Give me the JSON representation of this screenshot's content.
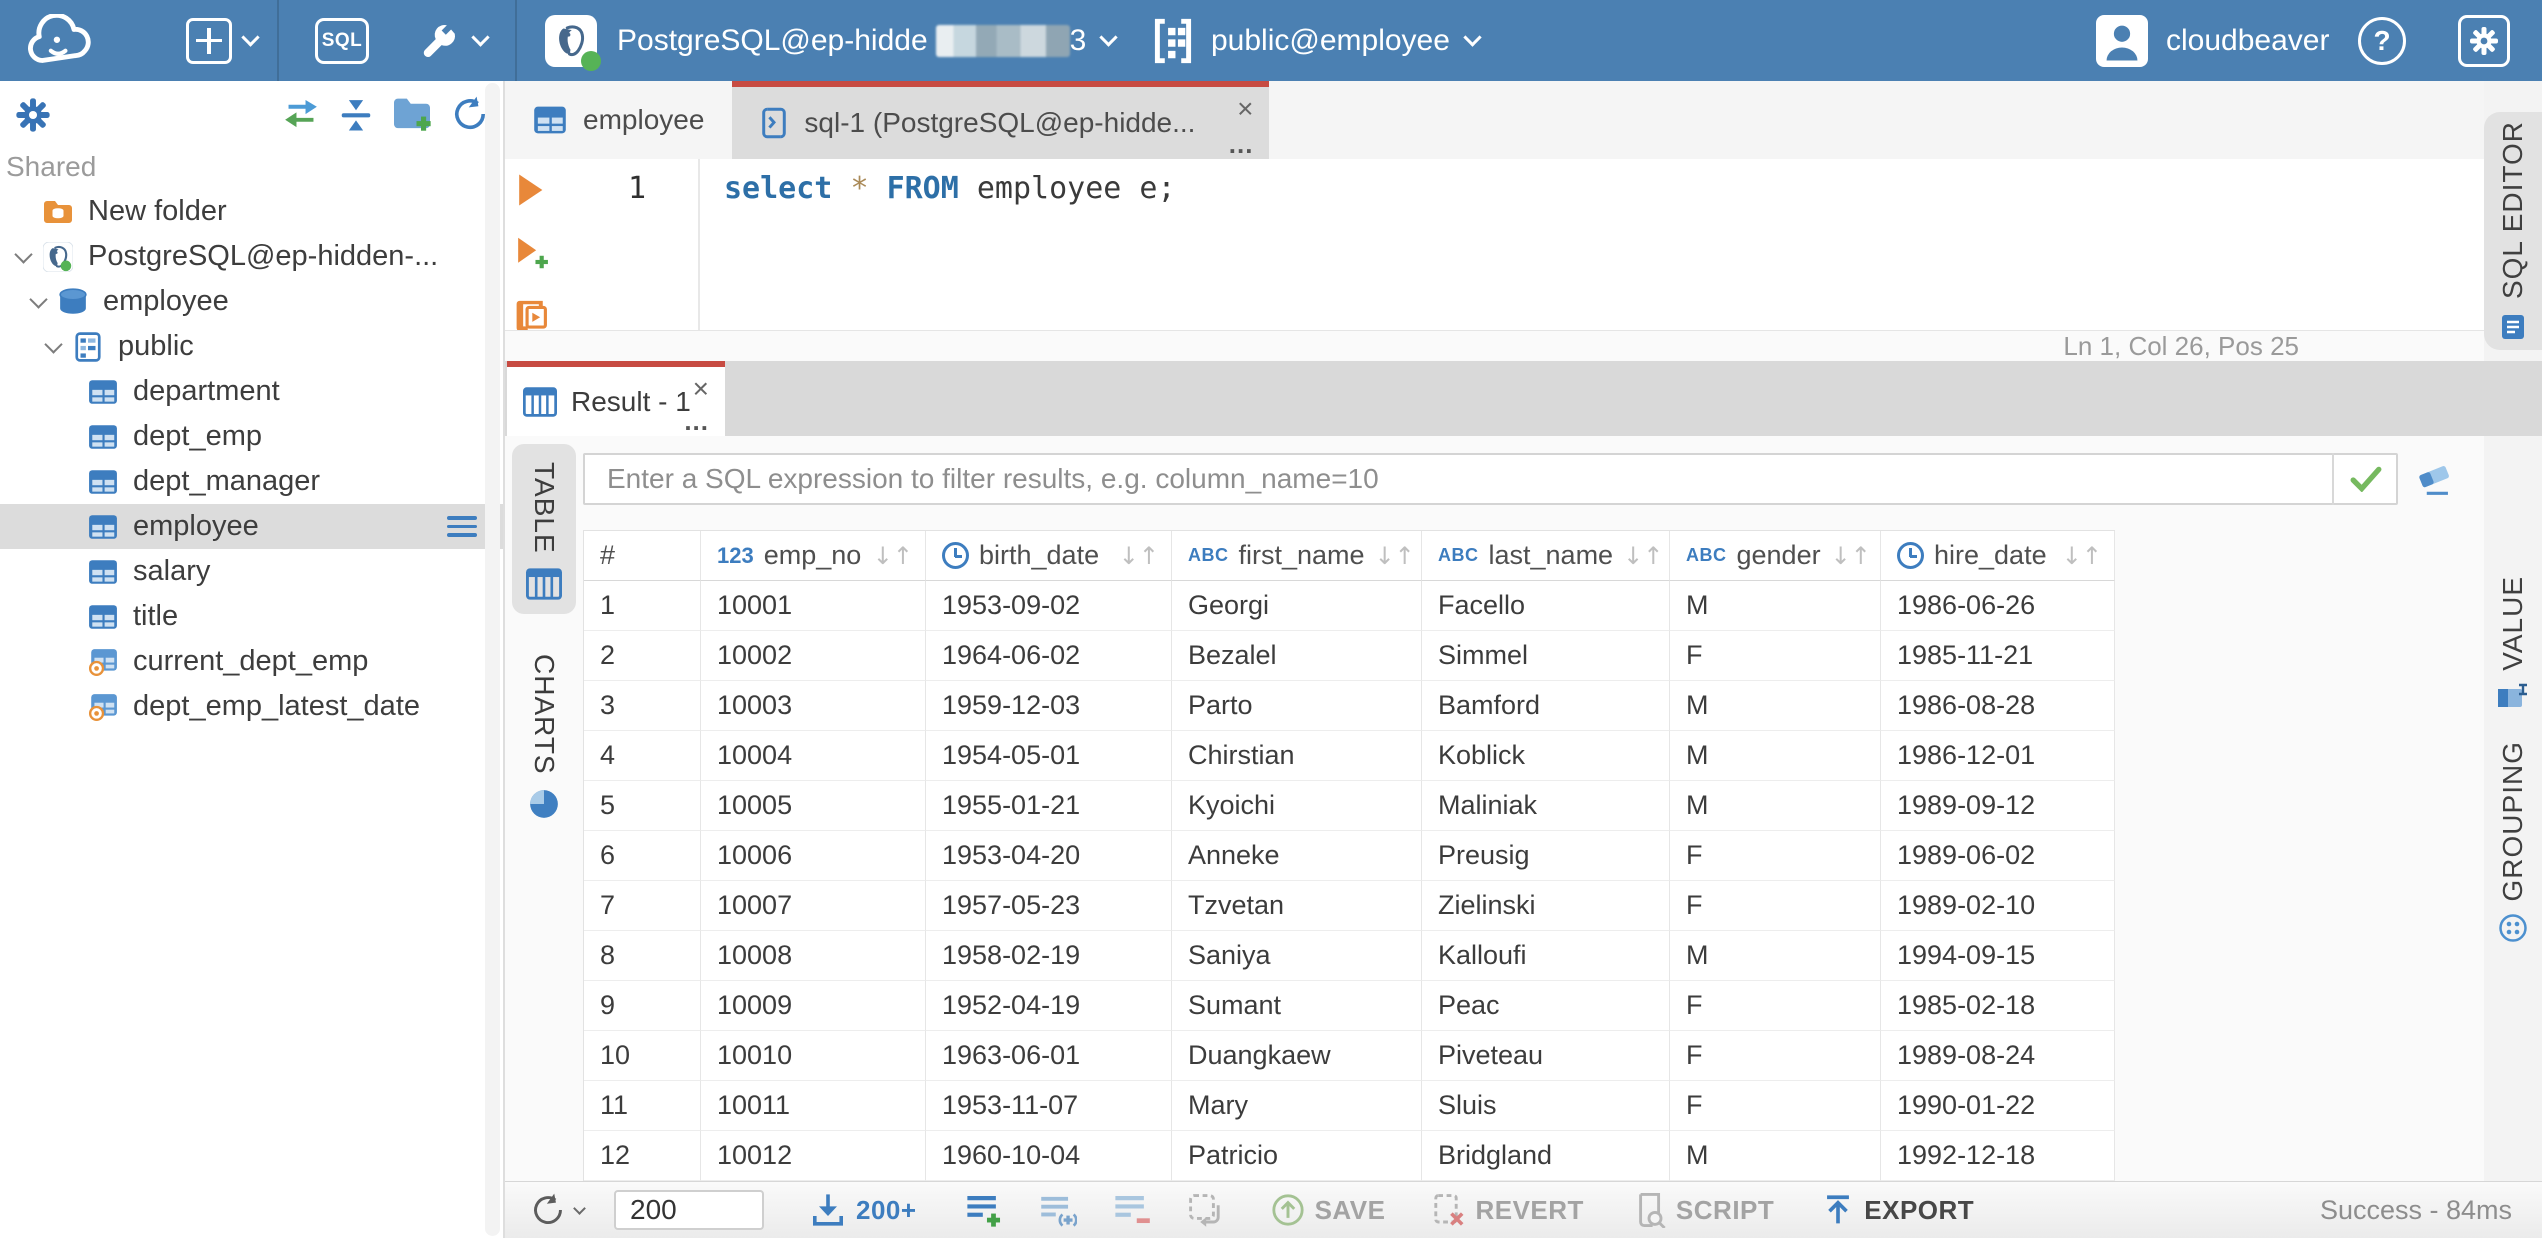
{
  "colors": {
    "topbar": "#4b80b2",
    "accent_red": "#c74b42",
    "icon_blue": "#3d7dbf",
    "status_green": "#56b356",
    "selected_gray": "#dcdcdc"
  },
  "topbar": {
    "new_object_tooltip": "new-object",
    "sql_badge": "SQL",
    "connection": {
      "name_visible": "PostgreSQL@ep-hidde",
      "name_suffix": "3"
    },
    "schema": "public@employee",
    "user": "cloudbeaver",
    "help_glyph": "?"
  },
  "sidebar": {
    "section": "Shared",
    "items": [
      {
        "label": "New folder",
        "icon": "folder-db",
        "level": 0,
        "chevron": false
      },
      {
        "label": "PostgreSQL@ep-hidden-...",
        "icon": "postgres",
        "level": 0,
        "chevron": true
      },
      {
        "label": "employee",
        "icon": "database",
        "level": 1,
        "chevron": true
      },
      {
        "label": "public",
        "icon": "schema",
        "level": 2,
        "chevron": true
      },
      {
        "label": "department",
        "icon": "table",
        "level": 3,
        "chevron": false
      },
      {
        "label": "dept_emp",
        "icon": "table",
        "level": 3,
        "chevron": false
      },
      {
        "label": "dept_manager",
        "icon": "table",
        "level": 3,
        "chevron": false
      },
      {
        "label": "employee",
        "icon": "table",
        "level": 3,
        "chevron": false,
        "selected": true
      },
      {
        "label": "salary",
        "icon": "table",
        "level": 3,
        "chevron": false
      },
      {
        "label": "title",
        "icon": "table",
        "level": 3,
        "chevron": false
      },
      {
        "label": "current_dept_emp",
        "icon": "view",
        "level": 3,
        "chevron": false
      },
      {
        "label": "dept_emp_latest_date",
        "icon": "view",
        "level": 3,
        "chevron": false
      }
    ]
  },
  "editor_tabs": [
    {
      "label": "employee"
    },
    {
      "label": "sql-1 (PostgreSQL@ep-hidde..."
    }
  ],
  "tabs_meta": {
    "close": "×",
    "more": "..."
  },
  "sql": {
    "line_number": "1",
    "kw1": "select",
    "sp1": " ",
    "star": "*",
    "sp2": " ",
    "kw2": "FROM",
    "rest": " employee e;",
    "status": "Ln 1, Col 26, Pos 25"
  },
  "right_rail": {
    "editor_tab": "SQL EDITOR",
    "value_tab": "VALUE",
    "grouping_tab": "GROUPING"
  },
  "result": {
    "tab": "Result - 1",
    "filter_placeholder": "Enter a SQL expression to filter results, e.g. column_name=10",
    "left_tabs": [
      {
        "label": "TABLE"
      },
      {
        "label": "CHARTS"
      }
    ],
    "grid": {
      "row_header": "#",
      "sort_glyph": "↓↑",
      "type_badges": {
        "number": "123",
        "string": "ABC"
      },
      "columns": [
        {
          "name": "emp_no",
          "type": "number"
        },
        {
          "name": "birth_date",
          "type": "date"
        },
        {
          "name": "first_name",
          "type": "string"
        },
        {
          "name": "last_name",
          "type": "string"
        },
        {
          "name": "gender",
          "type": "string"
        },
        {
          "name": "hire_date",
          "type": "date"
        }
      ],
      "rows": [
        [
          "1",
          "10001",
          "1953-09-02",
          "Georgi",
          "Facello",
          "M",
          "1986-06-26"
        ],
        [
          "2",
          "10002",
          "1964-06-02",
          "Bezalel",
          "Simmel",
          "F",
          "1985-11-21"
        ],
        [
          "3",
          "10003",
          "1959-12-03",
          "Parto",
          "Bamford",
          "M",
          "1986-08-28"
        ],
        [
          "4",
          "10004",
          "1954-05-01",
          "Chirstian",
          "Koblick",
          "M",
          "1986-12-01"
        ],
        [
          "5",
          "10005",
          "1955-01-21",
          "Kyoichi",
          "Maliniak",
          "M",
          "1989-09-12"
        ],
        [
          "6",
          "10006",
          "1953-04-20",
          "Anneke",
          "Preusig",
          "F",
          "1989-06-02"
        ],
        [
          "7",
          "10007",
          "1957-05-23",
          "Tzvetan",
          "Zielinski",
          "F",
          "1989-02-10"
        ],
        [
          "8",
          "10008",
          "1958-02-19",
          "Saniya",
          "Kalloufi",
          "M",
          "1994-09-15"
        ],
        [
          "9",
          "10009",
          "1952-04-19",
          "Sumant",
          "Peac",
          "F",
          "1985-02-18"
        ],
        [
          "10",
          "10010",
          "1963-06-01",
          "Duangkaew",
          "Piveteau",
          "F",
          "1989-08-24"
        ],
        [
          "11",
          "10011",
          "1953-11-07",
          "Mary",
          "Sluis",
          "F",
          "1990-01-22"
        ],
        [
          "12",
          "10012",
          "1960-10-04",
          "Patricio",
          "Bridgland",
          "M",
          "1992-12-18"
        ]
      ]
    },
    "toolbar": {
      "row_limit": "200",
      "fetch_label": "200+",
      "save": "SAVE",
      "revert": "REVERT",
      "script": "SCRIPT",
      "export": "EXPORT",
      "status": "Success - 84ms"
    }
  }
}
